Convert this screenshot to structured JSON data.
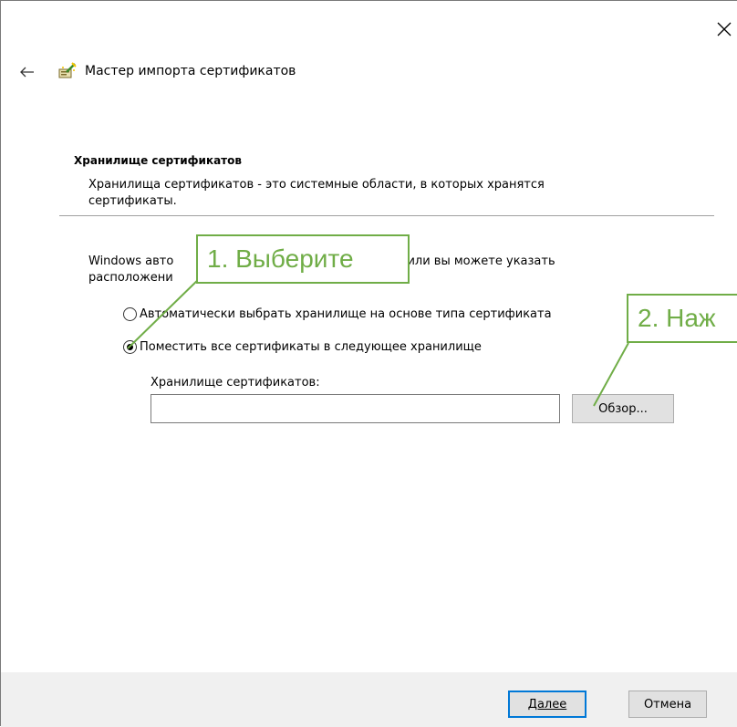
{
  "window": {
    "title": "Мастер импорта сертификатов",
    "close_icon": "close-icon",
    "back_icon": "arrow-left-icon",
    "wizard_icon": "certificate-wizard-icon"
  },
  "section": {
    "title": "Хранилище сертификатов",
    "description": "Хранилища сертификатов - это системные области, в которых хранятся сертификаты."
  },
  "intro": {
    "part1": "Windows авто",
    "part2": "це, или вы можете указать",
    "part3": "расположени"
  },
  "options": [
    {
      "label": "Автоматически выбрать хранилище на основе типа сертификата",
      "selected": false
    },
    {
      "label": "Поместить все сертификаты в следующее хранилище",
      "selected": true
    }
  ],
  "store": {
    "label": "Хранилище сертификатов:",
    "value": "",
    "browse_label": "Обзор..."
  },
  "footer": {
    "next_label": "Далее",
    "cancel_label": "Отмена"
  },
  "callouts": {
    "step1": "1. Выберите",
    "step2": "2. Наж"
  },
  "colors": {
    "callout_green": "#70ad47",
    "primary_border": "#0078d7",
    "footer_bg": "#f0f0f0"
  }
}
